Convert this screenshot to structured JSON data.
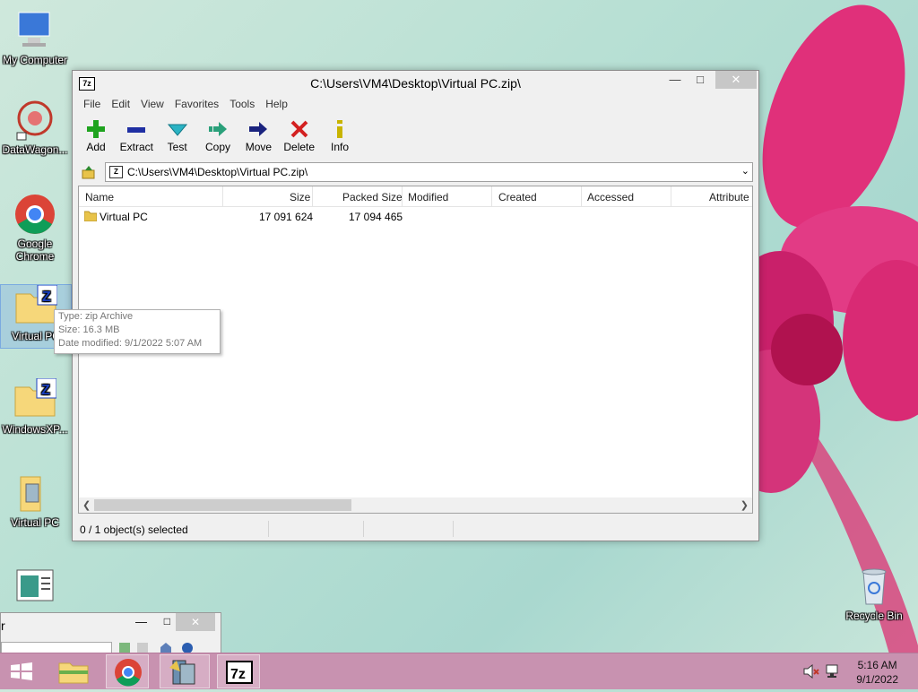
{
  "desktop": {
    "icons": [
      {
        "label": "My Computer"
      },
      {
        "label": "DataWagon..."
      },
      {
        "label": "Google Chrome"
      },
      {
        "label": "Virtual PC"
      },
      {
        "label": "WindowsXP..."
      },
      {
        "label": "Virtual PC"
      },
      {
        "label": ""
      },
      {
        "label": "Recycle Bin"
      }
    ]
  },
  "tooltip": {
    "type": "Type: zip Archive",
    "size": "Size: 16.3 MB",
    "modified": "Date modified: 9/1/2022 5:07 AM"
  },
  "window": {
    "title": "C:\\Users\\VM4\\Desktop\\Virtual PC.zip\\",
    "app_icon": "7z",
    "menu": [
      "File",
      "Edit",
      "View",
      "Favorites",
      "Tools",
      "Help"
    ],
    "toolbar": [
      {
        "label": "Add",
        "icon": "plus-icon",
        "color": "#1fa31f"
      },
      {
        "label": "Extract",
        "icon": "minus-icon",
        "color": "#1f2fa3"
      },
      {
        "label": "Test",
        "icon": "check-icon",
        "color": "#2bb3c4"
      },
      {
        "label": "Copy",
        "icon": "copy-arrow-icon",
        "color": "#2aa07a"
      },
      {
        "label": "Move",
        "icon": "move-arrow-icon",
        "color": "#1a237e"
      },
      {
        "label": "Delete",
        "icon": "delete-x-icon",
        "color": "#d32020"
      },
      {
        "label": "Info",
        "icon": "info-icon",
        "color": "#c8b400"
      }
    ],
    "address": "C:\\Users\\VM4\\Desktop\\Virtual PC.zip\\",
    "columns": [
      "Name",
      "Size",
      "Packed Size",
      "Modified",
      "Created",
      "Accessed",
      "Attribute"
    ],
    "rows": [
      {
        "name": "Virtual PC",
        "size": "17 091 624",
        "packed_size": "17 094 465",
        "modified": "",
        "created": "",
        "accessed": "",
        "attributes": ""
      }
    ],
    "status": "0 / 1 object(s) selected"
  },
  "mini_window": {
    "title": "r"
  },
  "taskbar": {
    "items": [
      "start-icon",
      "file-explorer-icon",
      "chrome-icon",
      "virtual-pc-icon",
      "7zip-icon"
    ],
    "time": "5:16 AM",
    "date": "9/1/2022"
  },
  "colors": {
    "taskbar": "#c892b0",
    "flower": "#e0307a",
    "window_bg": "#f0f0f0"
  }
}
